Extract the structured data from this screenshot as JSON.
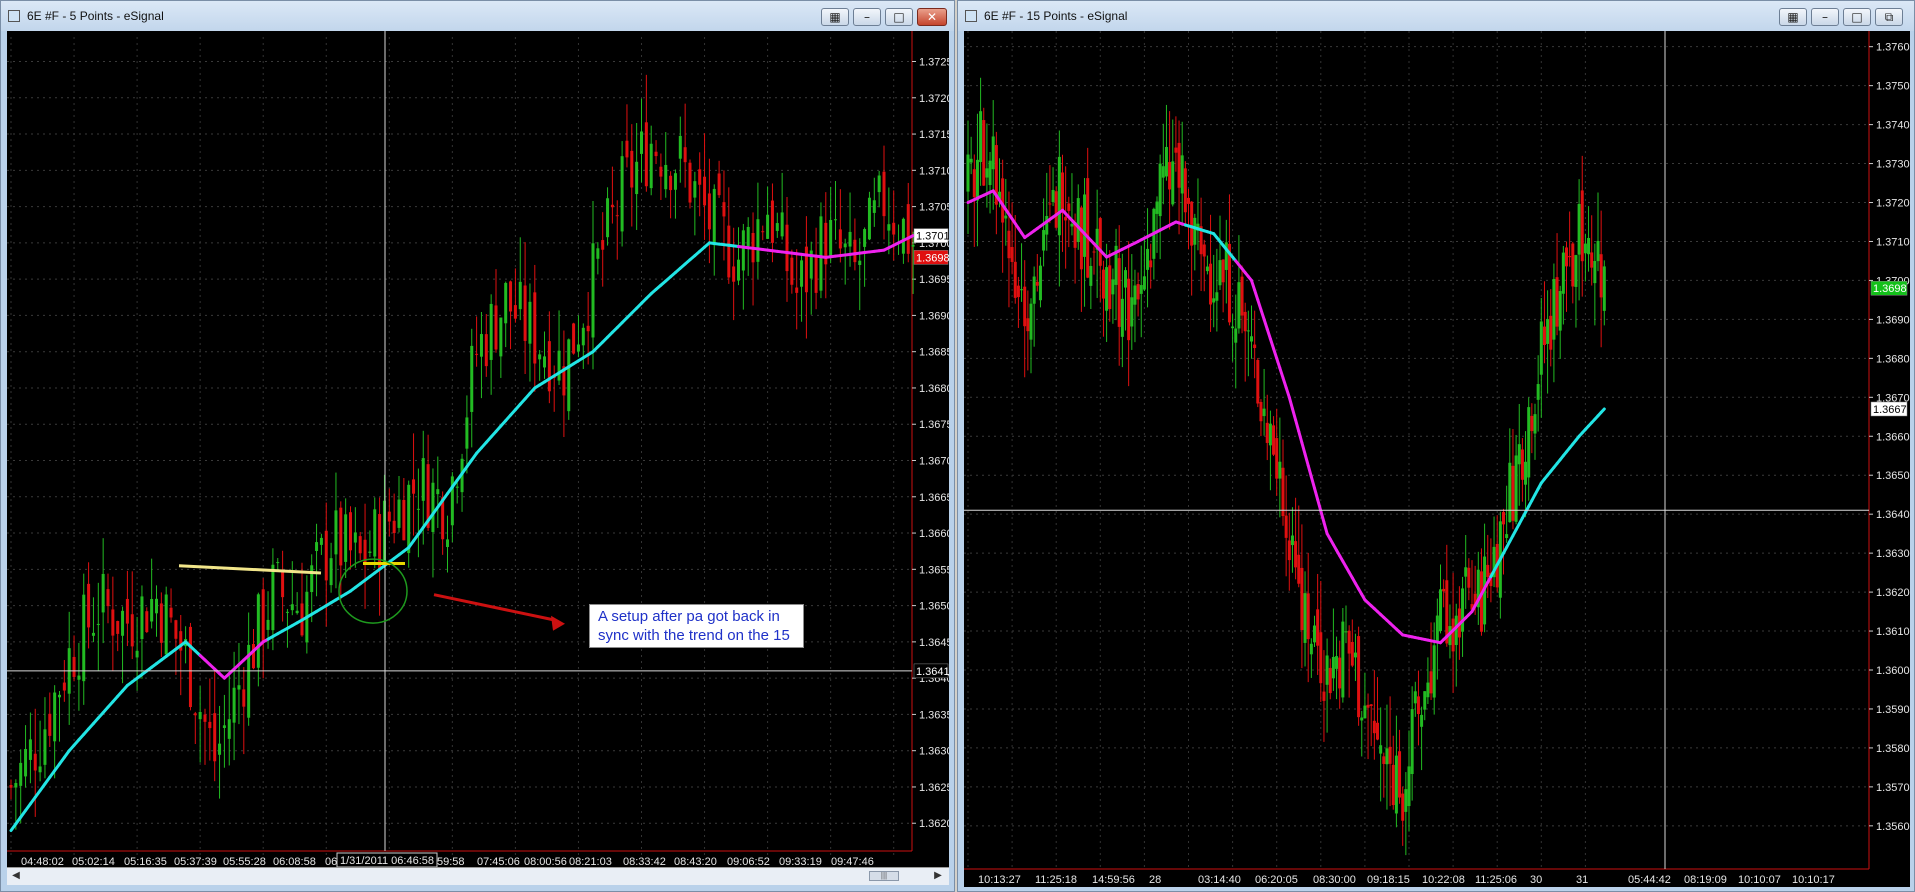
{
  "windows": [
    {
      "title": "6E #F - 5 Points - eSignal",
      "price_labels": [
        "1.3725",
        "1.3720",
        "1.3715",
        "1.3710",
        "1.3705",
        "1.3700",
        "1.3695",
        "1.3690",
        "1.3685",
        "1.3680",
        "1.3675",
        "1.3670",
        "1.3665",
        "1.3660",
        "1.3655",
        "1.3650",
        "1.3645",
        "1.3640",
        "1.3635",
        "1.3630",
        "1.3625",
        "1.3620"
      ],
      "time_labels": [
        "04:48:02",
        "05:02:14",
        "05:16:35",
        "05:37:39",
        "05:55:28",
        "06:08:58",
        "06",
        "59:58",
        "07:45:06",
        "08:00:56",
        "08:21:03",
        "08:33:42",
        "08:43:20",
        "09:06:52",
        "09:33:19",
        "09:47:46"
      ],
      "crosshair_time": "1/31/2011 06:46:58",
      "crosshair_price": "1.3641",
      "last_price": "1.3701",
      "bid_price": "1.3698",
      "annotation": "A setup after pa got back in sync with the trend on the 15"
    },
    {
      "title": "6E #F - 15 Points - eSignal",
      "price_labels": [
        "1.3760",
        "1.3750",
        "1.3740",
        "1.3730",
        "1.3720",
        "1.3710",
        "1.3700",
        "1.3690",
        "1.3680",
        "1.3670",
        "1.3660",
        "1.3650",
        "1.3640",
        "1.3630",
        "1.3620",
        "1.3610",
        "1.3600",
        "1.3590",
        "1.3580",
        "1.3570",
        "1.3560"
      ],
      "time_labels": [
        "10:13:27",
        "11:25:18",
        "14:59:56",
        "28",
        "03:14:40",
        "06:20:05",
        "08:30:00",
        "09:18:15",
        "10:22:08",
        "11:25:06",
        "30",
        "31",
        "05:44:42",
        "08:19:09",
        "10:10:07",
        "10:10:17"
      ],
      "last_price": "1.3698",
      "ma_price": "1.3667"
    }
  ],
  "colors": {
    "background": "#000000",
    "up_candle": "#22bb22",
    "down_candle": "#e01010",
    "ma_up": "#22e5e5",
    "ma_down": "#ee22ee",
    "crosshair": "#d8d8d8",
    "trendline": "#f2e68a",
    "arrow": "#cc1111",
    "circle": "#1e9a1e"
  },
  "chart_data": [
    {
      "type": "candlestick",
      "title": "6E #F - 5 Points - eSignal",
      "ylim": [
        1.3617,
        1.3727
      ],
      "y_ticks": [
        1.3725,
        1.372,
        1.3715,
        1.371,
        1.3705,
        1.37,
        1.3695,
        1.369,
        1.3685,
        1.368,
        1.3675,
        1.367,
        1.3665,
        1.366,
        1.3655,
        1.365,
        1.3645,
        1.364,
        1.3635,
        1.363,
        1.3625,
        1.362
      ],
      "x_ticks": [
        "04:48:02",
        "05:02:14",
        "05:16:35",
        "05:37:39",
        "05:55:28",
        "06:08:58",
        "06:46:58",
        "07:45:06",
        "08:00:56",
        "08:21:03",
        "08:33:42",
        "08:43:20",
        "09:06:52",
        "09:33:19",
        "09:47:46"
      ],
      "close_path": [
        [
          0,
          1.3625
        ],
        [
          6,
          1.3632
        ],
        [
          12,
          1.3643
        ],
        [
          18,
          1.365
        ],
        [
          24,
          1.3648
        ],
        [
          30,
          1.3651
        ],
        [
          36,
          1.3643
        ],
        [
          42,
          1.3629
        ],
        [
          48,
          1.3641
        ],
        [
          54,
          1.3652
        ],
        [
          60,
          1.365
        ],
        [
          66,
          1.3659
        ],
        [
          72,
          1.3656
        ],
        [
          78,
          1.3662
        ],
        [
          84,
          1.3667
        ],
        [
          90,
          1.3664
        ],
        [
          96,
          1.3685
        ],
        [
          102,
          1.3692
        ],
        [
          108,
          1.3687
        ],
        [
          114,
          1.3683
        ],
        [
          120,
          1.3695
        ],
        [
          126,
          1.3707
        ],
        [
          132,
          1.3714
        ],
        [
          138,
          1.3711
        ],
        [
          144,
          1.3703
        ],
        [
          150,
          1.3698
        ],
        [
          156,
          1.3705
        ],
        [
          162,
          1.3693
        ],
        [
          168,
          1.3701
        ],
        [
          174,
          1.3696
        ],
        [
          180,
          1.3706
        ],
        [
          186,
          1.37
        ]
      ],
      "ma_path": [
        [
          0,
          1.3619
        ],
        [
          12,
          1.363
        ],
        [
          24,
          1.3639
        ],
        [
          36,
          1.3645
        ],
        [
          44,
          1.364
        ],
        [
          52,
          1.3645
        ],
        [
          60,
          1.3648
        ],
        [
          70,
          1.3652
        ],
        [
          82,
          1.3658
        ],
        [
          96,
          1.3671
        ],
        [
          108,
          1.368
        ],
        [
          120,
          1.3685
        ],
        [
          132,
          1.3693
        ],
        [
          144,
          1.37
        ],
        [
          156,
          1.3699
        ],
        [
          168,
          1.3698
        ],
        [
          180,
          1.3699
        ],
        [
          186,
          1.3701
        ]
      ],
      "ma_magenta_ranges": [
        [
          39,
          52
        ],
        [
          150,
          186
        ]
      ]
    },
    {
      "type": "candlestick",
      "title": "6E #F - 15 Points - eSignal",
      "ylim": [
        1.3552,
        1.3763
      ],
      "y_ticks": [
        1.376,
        1.375,
        1.374,
        1.373,
        1.372,
        1.371,
        1.37,
        1.369,
        1.368,
        1.367,
        1.366,
        1.365,
        1.364,
        1.363,
        1.362,
        1.361,
        1.36,
        1.359,
        1.358,
        1.357,
        1.356
      ],
      "x_ticks": [
        "10:13:27",
        "11:25:18",
        "14:59:56",
        "28",
        "03:14:40",
        "06:20:05",
        "08:30:00",
        "09:18:15",
        "10:22:08",
        "11:25:06",
        "30",
        "31",
        "05:44:42",
        "08:19:09",
        "10:10:07",
        "10:10:17"
      ],
      "close_path": [
        [
          0,
          1.3722
        ],
        [
          6,
          1.3738
        ],
        [
          12,
          1.3712
        ],
        [
          18,
          1.3695
        ],
        [
          24,
          1.3705
        ],
        [
          30,
          1.3728
        ],
        [
          36,
          1.3712
        ],
        [
          42,
          1.3708
        ],
        [
          48,
          1.3698
        ],
        [
          54,
          1.3692
        ],
        [
          60,
          1.3722
        ],
        [
          66,
          1.3728
        ],
        [
          72,
          1.3708
        ],
        [
          78,
          1.3702
        ],
        [
          84,
          1.3698
        ],
        [
          90,
          1.368
        ],
        [
          96,
          1.366
        ],
        [
          102,
          1.3638
        ],
        [
          108,
          1.3612
        ],
        [
          114,
          1.3598
        ],
        [
          120,
          1.3605
        ],
        [
          126,
          1.359
        ],
        [
          132,
          1.3575
        ],
        [
          138,
          1.3571
        ],
        [
          144,
          1.359
        ],
        [
          150,
          1.361
        ],
        [
          156,
          1.3618
        ],
        [
          162,
          1.3615
        ],
        [
          168,
          1.363
        ],
        [
          174,
          1.365
        ],
        [
          180,
          1.3672
        ],
        [
          186,
          1.3692
        ],
        [
          192,
          1.3708
        ],
        [
          198,
          1.3712
        ],
        [
          202,
          1.3698
        ]
      ],
      "ma_path": [
        [
          0,
          1.372
        ],
        [
          8,
          1.3723
        ],
        [
          18,
          1.3711
        ],
        [
          30,
          1.3718
        ],
        [
          44,
          1.3706
        ],
        [
          54,
          1.371
        ],
        [
          66,
          1.3715
        ],
        [
          78,
          1.3712
        ],
        [
          90,
          1.37
        ],
        [
          102,
          1.367
        ],
        [
          114,
          1.3635
        ],
        [
          126,
          1.3618
        ],
        [
          138,
          1.3609
        ],
        [
          150,
          1.3607
        ],
        [
          160,
          1.3615
        ],
        [
          170,
          1.363
        ],
        [
          182,
          1.3648
        ],
        [
          194,
          1.366
        ],
        [
          202,
          1.3667
        ]
      ],
      "ma_magenta_ranges": [
        [
          0,
          68
        ],
        [
          85,
          165
        ]
      ]
    }
  ]
}
